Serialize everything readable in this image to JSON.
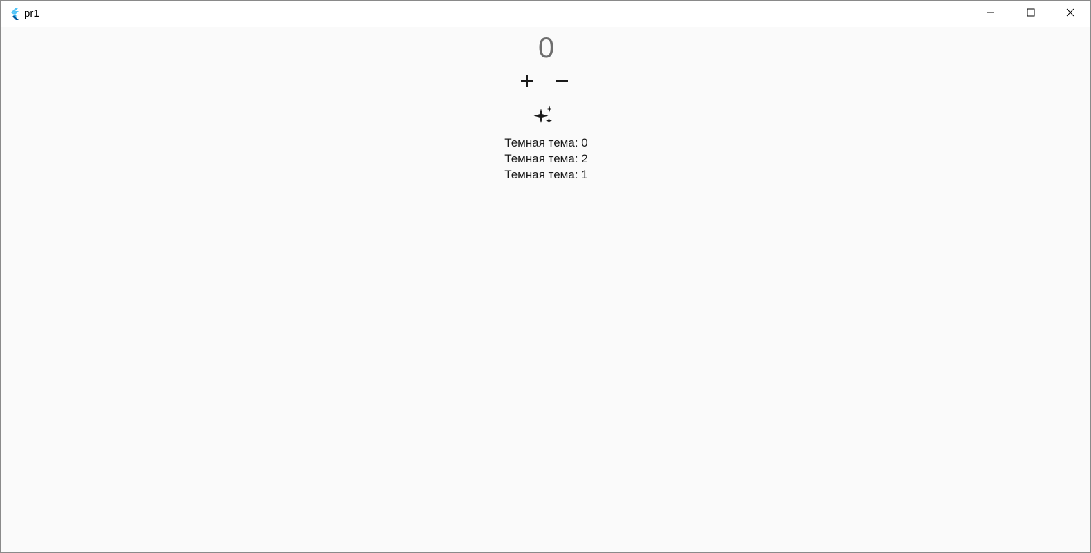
{
  "window": {
    "title": "pr1",
    "icons": {
      "logo": "flutter-logo-icon",
      "minimize": "minimize-icon",
      "maximize": "maximize-icon",
      "close": "close-icon"
    }
  },
  "main": {
    "counter": "0",
    "buttons": {
      "increment": "plus-icon",
      "decrement": "minus-icon",
      "theme": "sparkle-icon"
    },
    "theme_lines": [
      "Темная тема: 0",
      "Темная тема: 2",
      "Темная тема: 1"
    ]
  },
  "colors": {
    "background": "#fafafa",
    "titlebar": "#ffffff",
    "counter_text": "#6e6e6e",
    "icon": "#1a1a1a"
  }
}
